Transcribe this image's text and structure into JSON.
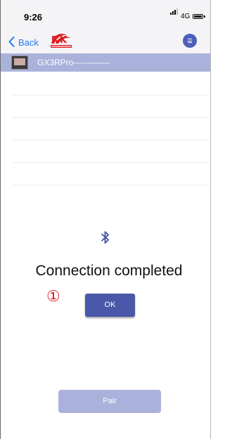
{
  "status_bar": {
    "time": "9:26",
    "network": "4G"
  },
  "nav": {
    "back_label": "Back",
    "logo": "rion-logo",
    "menu_icon": "menu-icon"
  },
  "device": {
    "name": "GX3RPro-------------"
  },
  "main": {
    "status_message": "Connection completed",
    "step_marker": "①",
    "ok_label": "OK",
    "pair_label": "Pair"
  },
  "colors": {
    "accent": "#4a58aa",
    "device_row_bg": "#aab2dc",
    "back_link": "#1e7cf5",
    "step_marker": "#e0191f"
  }
}
